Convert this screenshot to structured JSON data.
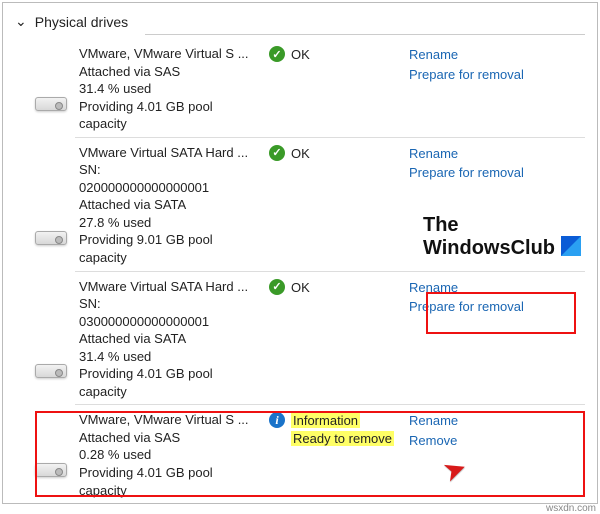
{
  "section": {
    "title": "Physical drives"
  },
  "actions": {
    "rename": "Rename",
    "prepare": "Prepare for removal",
    "remove": "Remove"
  },
  "status": {
    "ok": "OK",
    "info1": "Information",
    "info2": "Ready to remove"
  },
  "drives": [
    {
      "name": "VMware, VMware Virtual S ...",
      "l1": "Attached via SAS",
      "l2": "31.4 % used",
      "l3": "Providing 4.01 GB pool",
      "l4": "capacity",
      "status": "ok",
      "a1": "rename",
      "a2": "prepare"
    },
    {
      "name": "VMware Virtual SATA Hard ...",
      "l1": "SN:",
      "l2": "020000000000000001",
      "l3": "Attached via SATA",
      "l4": "27.8 % used",
      "l5": "Providing 9.01 GB pool",
      "l6": "capacity",
      "status": "ok",
      "a1": "rename",
      "a2": "prepare"
    },
    {
      "name": "VMware Virtual SATA Hard ...",
      "l1": "SN:",
      "l2": "030000000000000001",
      "l3": "Attached via SATA",
      "l4": "31.4 % used",
      "l5": "Providing 4.01 GB pool",
      "l6": "capacity",
      "status": "ok",
      "a1": "rename",
      "a2": "prepare"
    },
    {
      "name": "VMware, VMware Virtual S ...",
      "l1": "Attached via SAS",
      "l2": "0.28 % used",
      "l3": "Providing 4.01 GB pool",
      "l4": "capacity",
      "status": "info",
      "a1": "rename",
      "a2": "remove"
    }
  ],
  "watermark": {
    "l1": "The",
    "l2": "WindowsClub"
  },
  "attrib": "wsxdn.com"
}
